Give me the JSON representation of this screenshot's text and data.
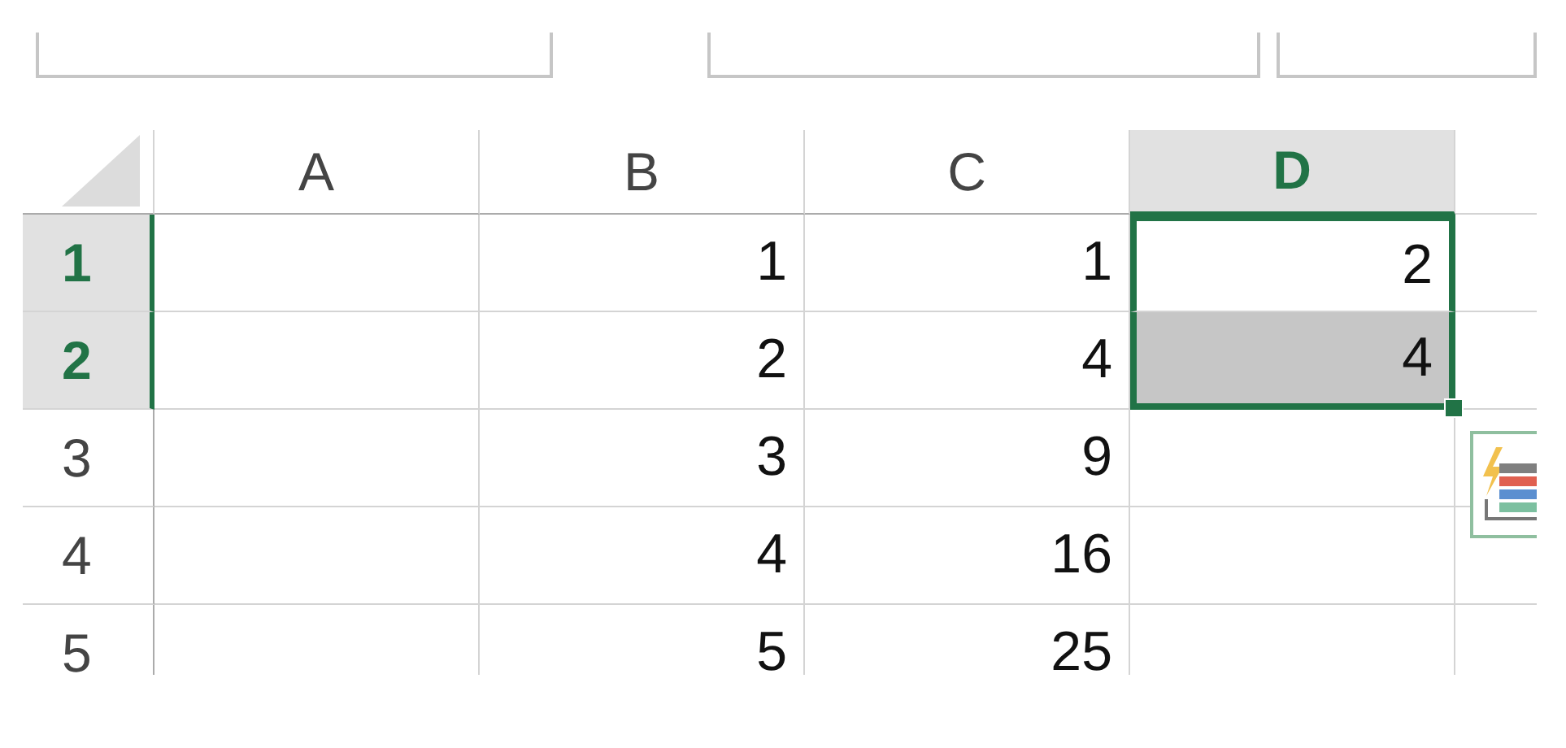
{
  "columns": [
    {
      "label": "A",
      "selected": false
    },
    {
      "label": "B",
      "selected": false
    },
    {
      "label": "C",
      "selected": false
    },
    {
      "label": "D",
      "selected": true
    }
  ],
  "rows": [
    {
      "label": "1",
      "selected": true,
      "cells": [
        {
          "selected": false
        },
        {
          "value": "1",
          "selected": false
        },
        {
          "value": "1",
          "selected": false
        },
        {
          "value": "2",
          "selected": true
        }
      ]
    },
    {
      "label": "2",
      "selected": true,
      "cells": [
        {
          "selected": false
        },
        {
          "value": "2",
          "selected": false
        },
        {
          "value": "4",
          "selected": false
        },
        {
          "value": "4",
          "selected": true
        }
      ]
    },
    {
      "label": "3",
      "selected": false,
      "cells": [
        {
          "selected": false
        },
        {
          "value": "3",
          "selected": false
        },
        {
          "value": "9",
          "selected": false
        },
        {
          "selected": false
        }
      ]
    },
    {
      "label": "4",
      "selected": false,
      "cells": [
        {
          "selected": false
        },
        {
          "value": "4",
          "selected": false
        },
        {
          "value": "16",
          "selected": false
        },
        {
          "selected": false
        }
      ]
    },
    {
      "label": "5",
      "selected": false,
      "cells": [
        {
          "selected": false
        },
        {
          "value": "5",
          "selected": false
        },
        {
          "value": "25",
          "selected": false
        },
        {
          "selected": false
        }
      ]
    }
  ]
}
